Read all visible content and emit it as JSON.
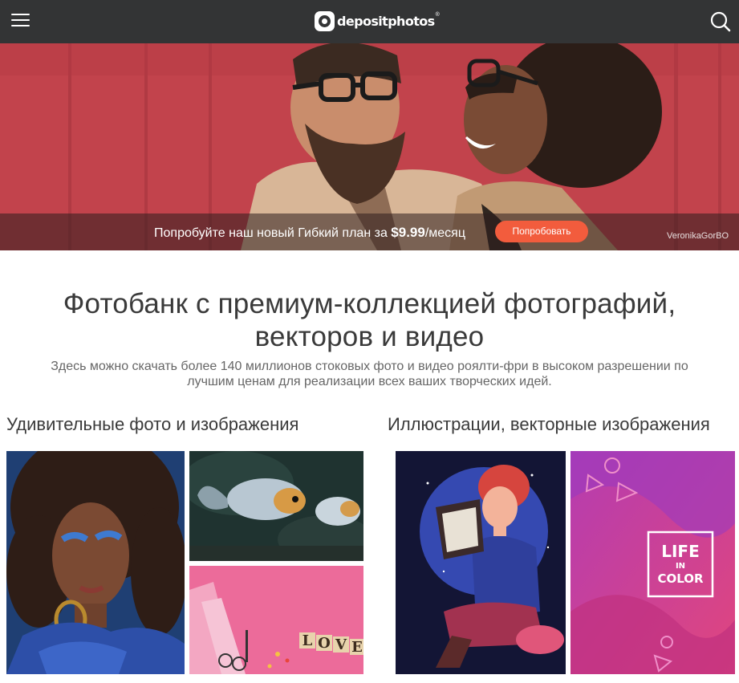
{
  "header": {
    "menu_icon": "hamburger-menu-icon",
    "logo_text": "depositphotos",
    "logo_mark": "®",
    "search_icon": "search-icon"
  },
  "hero": {
    "text_prefix": "Попробуйте наш новый Гибкий план за ",
    "price": "$9.99",
    "text_suffix": "/месяц",
    "button_label": "Попробовать",
    "credit": "VeronikaGorBO"
  },
  "main": {
    "headline": "Фотобанк с премиум-коллекцией фотографий, векторов и видео",
    "subline": "Здесь можно скачать более 140 миллионов стоковых фото и видео роялти-фри в высоком разрешении по лучшим ценам для реализации всех ваших творческих идей."
  },
  "sections": {
    "photos_title": "Удивительные фото и изображения",
    "vectors_title": "Иллюстрации, векторные изображения"
  },
  "tiles": {
    "life_line1": "LIFE",
    "life_line2": "IN",
    "life_line3": "COLOR",
    "love_letters": [
      "L",
      "O",
      "V",
      "E"
    ]
  },
  "colors": {
    "header_bg": "#333435",
    "accent": "#f25c3d",
    "hero_red": "#c8464f"
  }
}
